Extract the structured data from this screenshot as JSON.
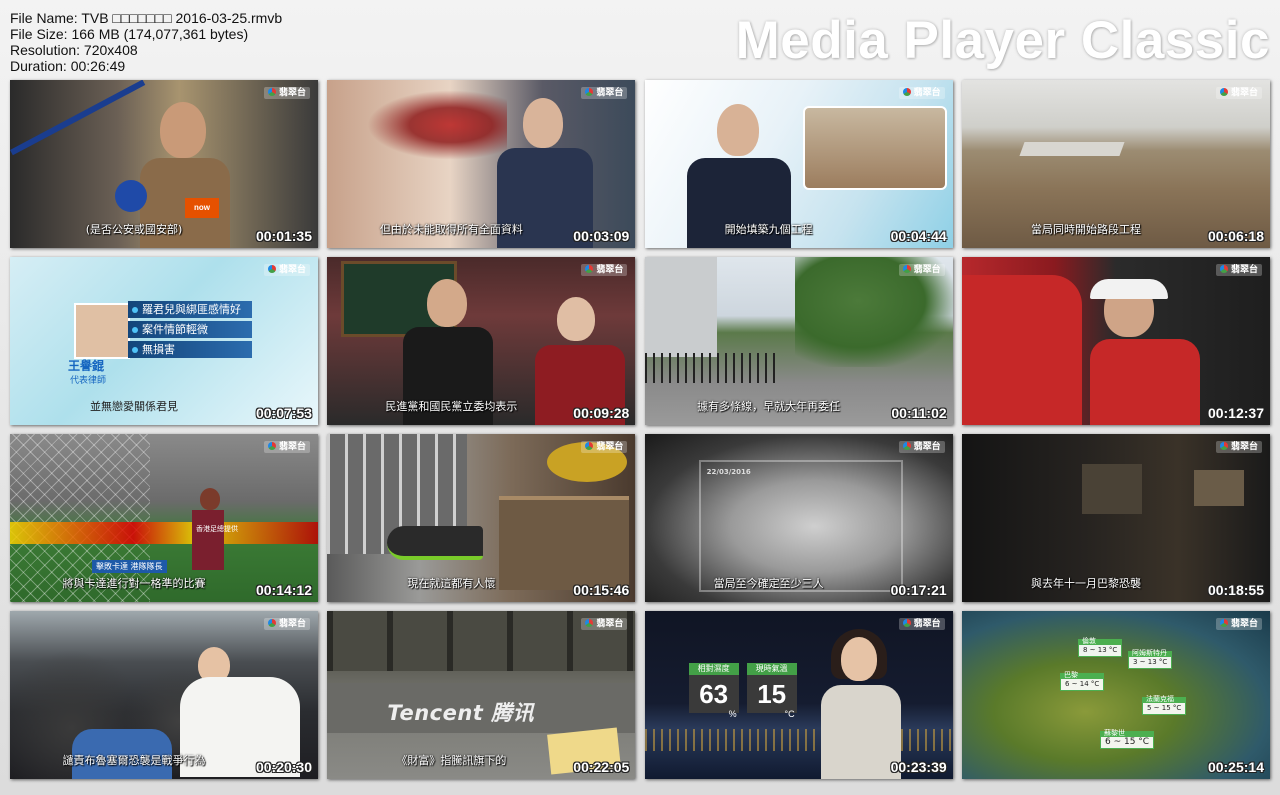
{
  "info": {
    "file_name": "File Name: TVB □□□□□□□ 2016-03-25.rmvb",
    "file_size": "File Size: 166 MB (174,077,361 bytes)",
    "resolution": "Resolution: 720x408",
    "duration": "Duration: 00:26:49"
  },
  "brand": "Media Player Classic",
  "logo_text": "翡翠台",
  "thumbs": [
    {
      "time": "00:01:35",
      "caption": "(是否公安或國安部)"
    },
    {
      "time": "00:03:09",
      "caption": "但由於未能取得所有全面資料"
    },
    {
      "time": "00:04:44",
      "caption": "開始填築九個工程"
    },
    {
      "time": "00:06:18",
      "caption": "當局同時開始路段工程"
    },
    {
      "time": "00:07:53",
      "caption": "並無戀愛關係君見",
      "bullets": [
        "羅君兒與綁匪感情好",
        "案件情節輕微",
        "無損害"
      ],
      "name": "王譽錕",
      "role": "代表律師"
    },
    {
      "time": "00:09:28",
      "caption": "民進黨和國民黨立委均表示"
    },
    {
      "time": "00:11:02",
      "caption": "據有多條線，早就大年再委任"
    },
    {
      "time": "00:12:37",
      "caption": ""
    },
    {
      "time": "00:14:12",
      "caption": "擊敗卡達 港隊隊長",
      "caption2": "將與卡達進行對一格準的比賽",
      "source": "香港足總提供"
    },
    {
      "time": "00:15:46",
      "caption": "現在就這都有人懷"
    },
    {
      "time": "00:17:21",
      "caption": "當局至今確定至少三人",
      "date": "22/03/2016"
    },
    {
      "time": "00:18:55",
      "caption": "與去年十一月巴黎恐襲"
    },
    {
      "time": "00:20:30",
      "caption": "譴責布魯塞爾恐襲是戰爭行為"
    },
    {
      "time": "00:22:05",
      "caption": "《財富》指騰訊旗下的",
      "brand": "Tencent 腾讯"
    },
    {
      "time": "00:23:39",
      "caption": "",
      "humidity_label": "相對濕度",
      "humidity": "63",
      "humidity_unit": "%",
      "temp_label": "現時氣溫",
      "temp": "15",
      "temp_unit": "°C"
    },
    {
      "time": "00:25:14",
      "caption": "",
      "cities": [
        {
          "name": "倫敦",
          "range": "8 ~ 13 °C"
        },
        {
          "name": "阿姆斯特丹",
          "range": "3 ~ 13 °C"
        },
        {
          "name": "巴黎",
          "range": "6 ~ 14 °C"
        },
        {
          "name": "法蘭克福",
          "range": "5 ~ 15 °C"
        },
        {
          "name": "蘇黎世",
          "range": "6 ~ 15 °C"
        }
      ]
    }
  ]
}
